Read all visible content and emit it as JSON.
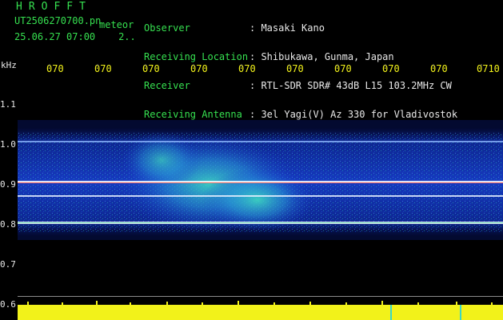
{
  "header": {
    "brand": "HROFFT",
    "filename": "UT2506270700.pn",
    "filename_tag": "meteor",
    "datetime": "25.06.27 07:00",
    "count": "2..",
    "info": [
      {
        "label": "Observer",
        "value": "Masaki Kano"
      },
      {
        "label": "Receiving Location",
        "value": "Shibukawa, Gunma, Japan"
      },
      {
        "label": "Receiver",
        "value": "RTL-SDR SDR# 43dB L15 103.2MHz CW"
      },
      {
        "label": "Receiving Antenna",
        "value": "3el Yagi(V) Az 330 for Vladivostok"
      }
    ]
  },
  "axis": {
    "unit": "kHz",
    "y_ticks": [
      "1.1",
      "1.0",
      "0.9",
      "0.8",
      "0.7",
      "0.6"
    ],
    "x_ticks": [
      "070",
      "070",
      "070",
      "070",
      "070",
      "070",
      "070",
      "070",
      "070",
      "0710"
    ]
  },
  "colors": {
    "background": "#000000",
    "text_green": "#36e050",
    "text_white": "#e8e8e8",
    "text_yellow": "#f2f21a",
    "noise_band": "#1633c8",
    "signal_line": "#ffffff",
    "meteor_cyan": "#39d6c8",
    "meteor_red": "#ff4030",
    "power_bar": "#f2f21a"
  }
}
